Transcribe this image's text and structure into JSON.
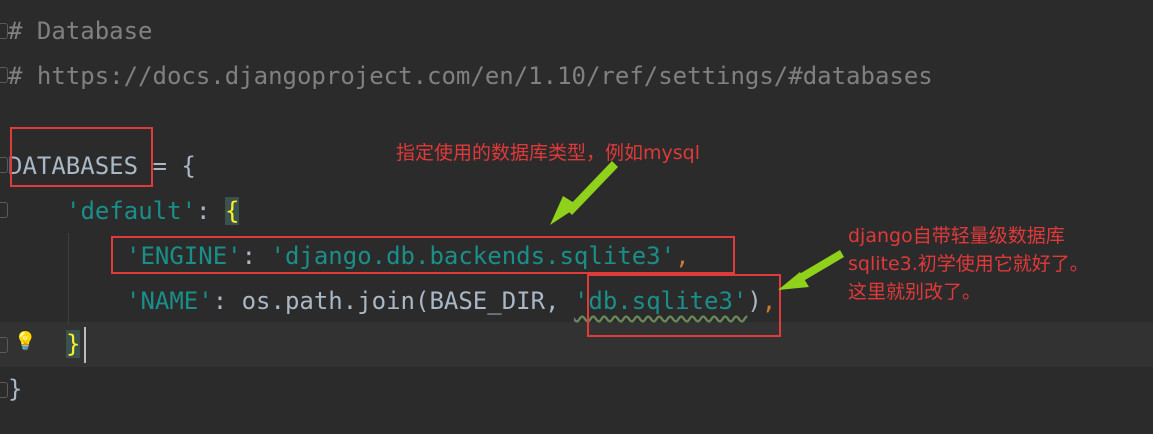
{
  "code": {
    "line1": "# Database",
    "line2": "# https://docs.djangoproject.com/en/1.10/ref/settings/#databases",
    "line3": {
      "name": "DATABASES",
      "op": " = ",
      "brace": "{"
    },
    "line4": {
      "key": "'default'",
      "colon": ": ",
      "brace": "{"
    },
    "line5": {
      "key": "'ENGINE'",
      "colon": ": ",
      "value": "'django.db.backends.sqlite3'",
      "comma": ","
    },
    "line6": {
      "key": "'NAME'",
      "colon": ": ",
      "call": "os.path.join(BASE_DIR, ",
      "value": "'db.sqlite3'",
      "close": ")",
      "comma": ","
    },
    "line7": {
      "brace": "}"
    },
    "line8": {
      "brace": "}"
    }
  },
  "annotations": {
    "engine_note": "指定使用的数据库类型，例如mysql",
    "sqlite_note": "django自带轻量级数据库\nsqlite3.初学使用它就好了。\n这里就别改了。"
  },
  "colors": {
    "background": "#2b2b2b",
    "annotation_red": "#e0393a",
    "arrow_green": "#8fd11b",
    "string": "#1a8f8a",
    "comment": "#808080"
  },
  "icons": {
    "hint": "lightbulb-icon"
  }
}
